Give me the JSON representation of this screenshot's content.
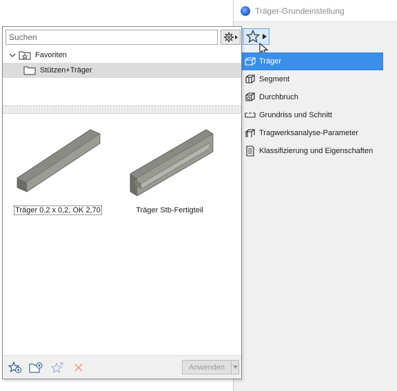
{
  "settings_window": {
    "title": "Träger-Grundeinstellung",
    "icon": "archicad-app-icon",
    "favorites_toggle_icon": "star-icon",
    "items": [
      {
        "label": "Träger",
        "icon": "beam-icon",
        "selected": true
      },
      {
        "label": "Segment",
        "icon": "segment-icon",
        "selected": false
      },
      {
        "label": "Durchbruch",
        "icon": "hole-icon",
        "selected": false
      },
      {
        "label": "Grundriss und Schnitt",
        "icon": "floorplan-section-icon",
        "selected": false
      },
      {
        "label": "Tragwerksanalyse-Parameter",
        "icon": "structural-analysis-icon",
        "selected": false
      },
      {
        "label": "Klassifizierung und Eigenschaften",
        "icon": "classification-icon",
        "selected": false
      }
    ]
  },
  "favorites_panel": {
    "search": {
      "placeholder": "Suchen",
      "value": ""
    },
    "tree": {
      "root": {
        "label": "Favoriten",
        "expanded": true
      },
      "folder": {
        "label": "Stützen+Träger"
      }
    },
    "items": [
      {
        "caption": "Träger 0,2 x 0,2, OK 2,70",
        "icon": "beam-box-thumbnail"
      },
      {
        "caption": "Träger Stb-Fertigteil",
        "icon": "precast-beam-thumbnail"
      }
    ],
    "toolbar": {
      "add_favorite_icon": "star-add-icon",
      "add_folder_icon": "folder-add-icon",
      "redefine_icon": "star-redefine-icon",
      "delete_icon": "delete-x-icon",
      "apply_label": "Anwenden"
    }
  }
}
